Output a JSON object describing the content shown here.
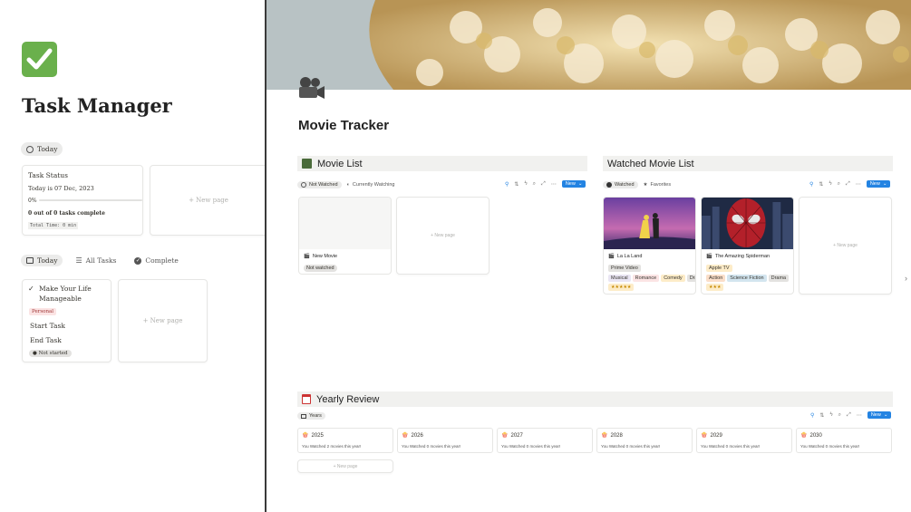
{
  "left": {
    "title": "Task Manager",
    "today_pill": "Today",
    "task_status": {
      "title": "Task Status",
      "date_line": "Today  is  07 Dec, 2023",
      "percent": "0%",
      "progress": 0,
      "complete_line": "0 out of 0 tasks complete",
      "total_time": "Total Time: 0 min"
    },
    "new_page": "+ New page",
    "view_tabs": [
      {
        "label": "Today",
        "icon": "calendar-icon",
        "active": true
      },
      {
        "label": "All Tasks",
        "icon": "list-icon",
        "active": false
      },
      {
        "label": "Complete",
        "icon": "check-circle-icon",
        "active": false
      }
    ],
    "task": {
      "title": "Make Your Life Manageable",
      "tag": "Personal",
      "start": "Start Task",
      "end": "End Task",
      "status": "Not started"
    }
  },
  "right": {
    "title": "Movie Tracker",
    "movie_list": {
      "heading": "Movie List",
      "tabs": [
        "Not Watched",
        "Currently Watching"
      ],
      "new_button": "New",
      "card": {
        "name": "New Movie",
        "status": "Not watched"
      },
      "new_page": "+ New page"
    },
    "watched_list": {
      "heading": "Watched Movie List",
      "tabs": [
        "Watched",
        "Favorites"
      ],
      "new_button": "New",
      "movies": [
        {
          "name": "La La Land",
          "platform": "Prime Video",
          "genres": [
            "Musical",
            "Romance",
            "Comedy",
            "Drama"
          ],
          "rating": "★★★★★"
        },
        {
          "name": "The Amazing Spiderman",
          "platform": "Apple TV",
          "genres": [
            "Action",
            "Science Fiction",
            "Drama"
          ],
          "rating": "★★★"
        }
      ],
      "new_page": "+ New page"
    },
    "yearly_review": {
      "heading": "Yearly Review",
      "tab": "Years",
      "new_button": "New",
      "years": [
        {
          "year": "2025",
          "summary": "You Watched 2 movies this year!"
        },
        {
          "year": "2026",
          "summary": "You Watched 0 movies this year!"
        },
        {
          "year": "2027",
          "summary": "You Watched 0 movies this year!"
        },
        {
          "year": "2028",
          "summary": "You Watched 0 movies this year!"
        },
        {
          "year": "2029",
          "summary": "You Watched 0 movies this year!"
        },
        {
          "year": "2030",
          "summary": "You Watched 0 movies this year!"
        }
      ],
      "new_page": "+ New page"
    }
  },
  "colors": {
    "accent": "#2383e2",
    "check_green": "#6ab04c",
    "tag_personal": "#fbe4e4"
  }
}
